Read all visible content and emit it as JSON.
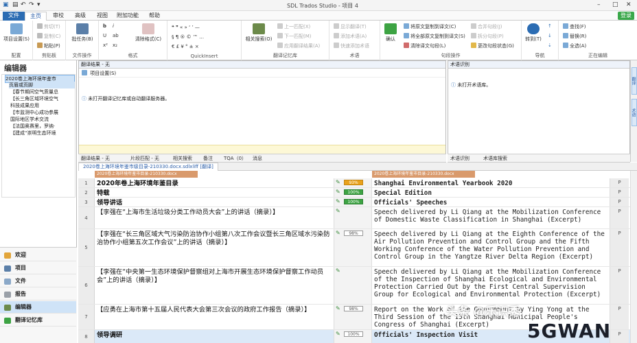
{
  "app": {
    "title": "SDL Trados Studio - 项目 4",
    "login_label": "登录"
  },
  "ribbon_tabs": [
    "文件",
    "主页",
    "审校",
    "高级",
    "视图",
    "附加功能",
    "帮助"
  ],
  "ribbon": {
    "groups": {
      "config": {
        "label": "配置",
        "button": "项目设置(S)"
      },
      "clipboard": {
        "label": "剪贴板",
        "cut": "剪切(T)",
        "copy": "复制(C)",
        "paste": "粘贴(P)"
      },
      "fileops": {
        "label": "文件操作",
        "button": "批任务(B)"
      },
      "format": {
        "label": "格式",
        "clear": "清除格式(C)"
      },
      "quickinsert": {
        "label": "QuickInsert"
      },
      "tm": {
        "label": "翻译记忆库",
        "search": "相关搜索(O)",
        "prev": "上一匹配(X)",
        "next": "下一匹配(M)",
        "apply": "应用翻译结果(A)"
      },
      "term": {
        "label": "术语",
        "display": "显示翻译(T)",
        "add_term": "添加术语(A)",
        "quick_add": "快速添加术语"
      },
      "segment": {
        "label": "句段操作",
        "confirm": "确认",
        "copy_src": "将原文复制到译文(C)",
        "copy_all": "将全部原文复制到译文(S)",
        "clear_tgt": "清除译文句段(L)",
        "merge": "合并句段(J)",
        "split": "拆分句段(P)",
        "change_status": "更改句段状态(G)"
      },
      "nav": {
        "label": "导航",
        "goto": "转到(T)"
      },
      "edit": {
        "label": "正在编辑",
        "find": "查找(F)",
        "replace": "替换(R)",
        "select_all": "全选(A)"
      }
    }
  },
  "left_panel": {
    "title": "编辑器",
    "tree": [
      "2020卷上海环境年鉴市",
      "页眉或页脚",
      "【春节期间空气质量总",
      "【长三角区域环境空气",
      "科技成果应用",
      "【市监测中心成功参展",
      "国际地区学术交流",
      "【法国奥赛里，罗纳·",
      "【建成“崇明生态环境"
    ],
    "nav": [
      "欢迎",
      "项目",
      "文件",
      "报告",
      "编辑器",
      "翻译记忆库"
    ]
  },
  "tm_panel": {
    "header": "翻译结果 - 无",
    "toolbar_label": "项目设置(S)",
    "message": "未打开翻译记忆库或自动翻译服务器。",
    "tabs": [
      "翻译结果 - 无",
      "片段匹配 - 无",
      "相关搜索",
      "备注",
      "TQA（0）",
      "消息"
    ]
  },
  "tb_panel": {
    "header": "术语识别",
    "message": "未打开术语库。",
    "tabs": [
      "术语识别",
      "术语库搜索"
    ]
  },
  "right_rail": [
    "翻译",
    "术语"
  ],
  "document": {
    "tab": "2020卷上海环境年鉴市级目录-210330.docx.sdlxliff [翻译]",
    "source_header": "2020卷上海环境年鉴市目录-210330.docx",
    "target_header": "2020卷上海环境年鉴市目录-210330.docx"
  },
  "segments": [
    {
      "n": "1",
      "src": "2020年卷上海环境年鉴目录",
      "tgt": "Shanghai Environmental Yearbook 2020",
      "pct": "93%",
      "pclass": "o",
      "bold": true,
      "lock": "P"
    },
    {
      "n": "2",
      "src": "特载",
      "tgt": "Special Edition",
      "pct": "100%",
      "pclass": "g",
      "bold": true,
      "lock": "P"
    },
    {
      "n": "3",
      "src": "领导讲话",
      "tgt": "Officials' Speeches",
      "pct": "100%",
      "pclass": "g",
      "bold": true,
      "lock": "P"
    },
    {
      "n": "4",
      "src": "【李强在“上海市生活垃圾分类工作动员大会”上的讲话（摘录）】",
      "tgt": "Speech delivered by Li Qiang at the Mobilization Conference of Domestic Waste Classification in Shanghai (Excerpt)",
      "pct": "",
      "pclass": "",
      "bold": false,
      "lock": "P"
    },
    {
      "n": "5",
      "src": "【李强在“长三角区域大气污染防治协作小组第八次工作会议暨长三角区域水污染防治协作小组第五次工作会议”上的讲话（摘录）】",
      "tgt": "Speech delivered by Li Qiang at the Eighth Conference of the Air Pollution Prevention and Control Group and the Fifth Working Conference of the Water Pollution Prevention and Control Group in the Yangtze River Delta Region (Excerpt)",
      "pct": "98%",
      "pclass": "",
      "bold": false,
      "lock": "P"
    },
    {
      "n": "6",
      "src": "【李强在“中央第一生态环境保护督察组对上海市开展生态环境保护督察工作动员会”上的讲话（摘录）】",
      "tgt": "Speech delivered by Li Qiang at the Mobilization Conference of the Inspection of Shanghai Ecological and Environmental Protection Carried Out by the First Central Supervision Group for Ecological and Environmental Protection (Excerpt)",
      "pct": "",
      "pclass": "",
      "bold": false,
      "lock": "P"
    },
    {
      "n": "7",
      "src": "【应勇在上海市第十五届人民代表大会第三次会议的政府工作报告（摘录）】",
      "tgt": "Report on the Work of the Government by Ying Yong at the Third Session of the 15th Shanghai Municipal People's Congress of Shanghai (Excerpt)",
      "pct": "98%",
      "pclass": "",
      "bold": false,
      "lock": "P"
    },
    {
      "n": "8",
      "src": "领导调研",
      "tgt": "Officials' Inspection Visit",
      "pct": "100%",
      "pclass": "",
      "bold": true,
      "lock": "P"
    }
  ],
  "watermark": {
    "line1": "头条 @乐识秀",
    "line2": "5GWAN"
  }
}
